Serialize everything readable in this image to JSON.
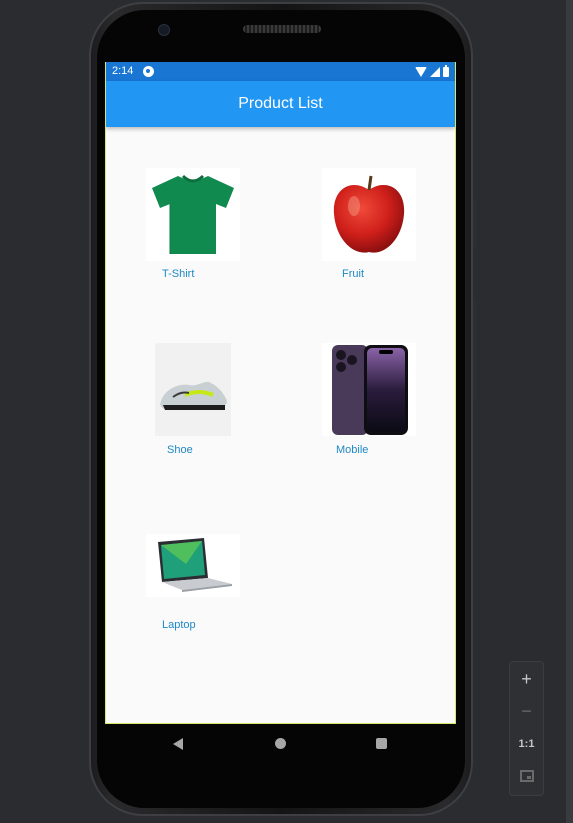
{
  "status_bar": {
    "time": "2:14"
  },
  "app_bar": {
    "title": "Product List"
  },
  "products": [
    {
      "label": "T-Shirt",
      "image": "green-tshirt"
    },
    {
      "label": "Fruit",
      "image": "red-apple"
    },
    {
      "label": "Shoe",
      "image": "running-shoe"
    },
    {
      "label": "Mobile",
      "image": "purple-smartphone"
    },
    {
      "label": "Laptop",
      "image": "silver-laptop"
    }
  ],
  "colors": {
    "app_bar": "#2196f3",
    "status_bar": "#1976d2",
    "label_text": "#1e88c8",
    "screen_background": "#fafafa"
  },
  "emulator_toolbar": {
    "zoom_in": "+",
    "zoom_out": "−",
    "actual_size": "1:1",
    "fit_icon": "fit-screen-icon"
  }
}
